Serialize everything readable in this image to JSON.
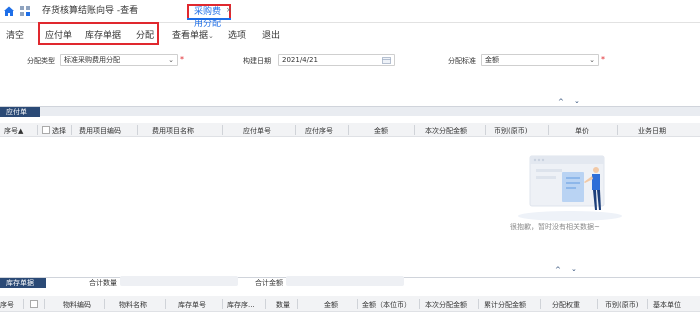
{
  "tabs": [
    {
      "label": "存货核算结账向导 -查看"
    },
    {
      "label": "采购费用分配",
      "close": "×"
    }
  ],
  "toolbar": {
    "clear": "清空",
    "payable": "应付单",
    "inventory_doc": "库存单据",
    "allocate": "分配",
    "view_doc": "查看单据",
    "view_doc_arrow": "⌄",
    "options": "选项",
    "exit": "退出"
  },
  "form": {
    "alloc_type_label": "分配类型",
    "alloc_type_value": "标准采购费用分配",
    "build_date_label": "构建日期",
    "build_date_value": "2021/4/21",
    "alloc_std_label": "分配标准",
    "alloc_std_value": "金额",
    "required_mark": "*",
    "dropdown_glyph": "⌄"
  },
  "payable_section": {
    "title": "应付单",
    "columns": [
      "序号▲",
      "选择",
      "费用项目编码",
      "费用项目名称",
      "应付单号",
      "应付序号",
      "金额",
      "本次分配金额",
      "币别(原币)",
      "单价",
      "业务日期"
    ],
    "empty_text": "很抱歉，暂时没有相关数据~"
  },
  "summary": {
    "qty_label": "合计数量",
    "amount_label": "合计金额"
  },
  "inventory_section": {
    "title": "库存单据",
    "columns": [
      "序号",
      "",
      "物料编码",
      "物料名称",
      "库存单号",
      "库存序...",
      "数量",
      "金额",
      "金额（本位币）",
      "本次分配金额",
      "累计分配金额",
      "分配权重",
      "币别(原币)",
      "基本单位"
    ]
  },
  "collapse_glyphs": {
    "up": "^",
    "down": "⌄"
  },
  "colors": {
    "accent": "#1f6fe8",
    "highlight": "#e0282e",
    "section": "#2b4a76"
  }
}
